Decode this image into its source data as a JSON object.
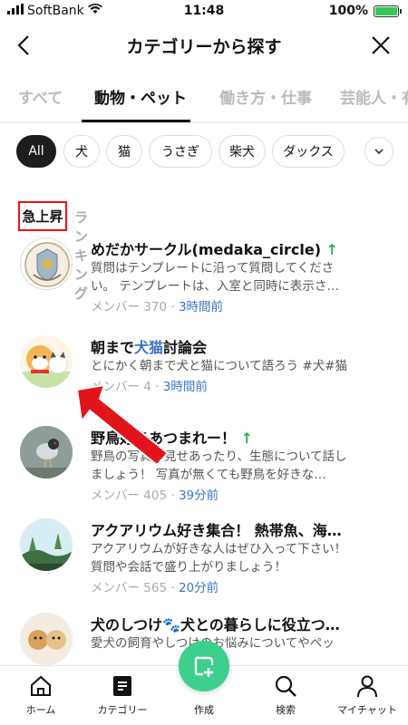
{
  "status_bar": {
    "carrier": "SoftBank",
    "time": "11:48",
    "battery": "100%"
  },
  "header": {
    "title": "カテゴリーから探す"
  },
  "tabs": [
    {
      "label": "すべて"
    },
    {
      "label": "動物・ペット"
    },
    {
      "label": "働き方・仕事"
    },
    {
      "label": "芸能人・有"
    }
  ],
  "chips": [
    {
      "label": "All"
    },
    {
      "label": "犬"
    },
    {
      "label": "猫"
    },
    {
      "label": "うさぎ"
    },
    {
      "label": "柴犬"
    },
    {
      "label": "ダックス"
    }
  ],
  "section": {
    "active": "急上昇",
    "inactive": "ランキング"
  },
  "items": [
    {
      "title": "めだかサークル(medaka_circle)",
      "trend": "↑",
      "desc": "質問はテンプレートに沿って質問してください。 テンプレートは、入室と同時に表示さ…",
      "members": "メンバー 370",
      "time": "3時間前"
    },
    {
      "title_pre": "朝まで",
      "title_hl": "犬猫",
      "title_post": "討論会",
      "desc": "とにかく朝まで犬と猫について語ろう #犬#猫",
      "members": "メンバー 4",
      "time": "3時間前"
    },
    {
      "title": "野鳥好きあつまれー！",
      "trend": "↑",
      "desc": "野鳥の写真を見せあったり、生態について話しましょう！ 写真が無くても野鳥を好きな…",
      "members": "メンバー 405",
      "time": "39分前"
    },
    {
      "title": "アクアリウム好き集合！ 熱帯魚、海…",
      "desc": "アクアリウムが好きな人はぜひ入って下さい！ 質問や会話で盛り上がりましょう！",
      "members": "メンバー 565",
      "time": "20分前"
    },
    {
      "title_pre": "犬のしつけ",
      "title_post": "犬との暮らしに役立つ…",
      "desc": "愛犬の飼育やしつけのお悩みについてやペッ"
    }
  ],
  "bottom_nav": {
    "home": "ホーム",
    "category": "カテゴリー",
    "create": "作成",
    "search": "検索",
    "mychat": "マイチャット"
  },
  "colors": {
    "accent_green": "#3ccf8e",
    "link_blue": "#3a73c9",
    "highlight_red": "#e11111"
  }
}
